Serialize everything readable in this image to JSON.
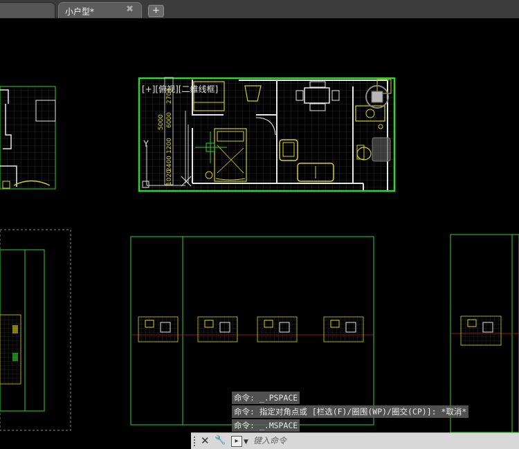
{
  "tabs": [
    {
      "label": ""
    },
    {
      "label": "小户型*",
      "close": "✖"
    }
  ],
  "new_tab_glyph": "+",
  "viewport_label": "[+][俯视][二维线框]",
  "dimension_labels": [
    "2700",
    "6000",
    "5000",
    "1200",
    "2400",
    "1020"
  ],
  "ucs_axis_label": "Y",
  "command_history": [
    "命令: _.PSPACE",
    "命令: 指定对角点或 [栏选(F)/圈围(WP)/圈交(CP)]: *取消*",
    "命令: _.MSPACE"
  ],
  "command_line": {
    "close_glyph": "✕",
    "wrench_glyph": "🔧",
    "prompt_glyph": "▸",
    "placeholder": "键入命令"
  },
  "colors": {
    "model_background": "#000000",
    "viewport_border": "#2fd42f",
    "furniture": "#d8d020",
    "walls": "#e8e8e8",
    "grid": "#2a2a2a"
  }
}
